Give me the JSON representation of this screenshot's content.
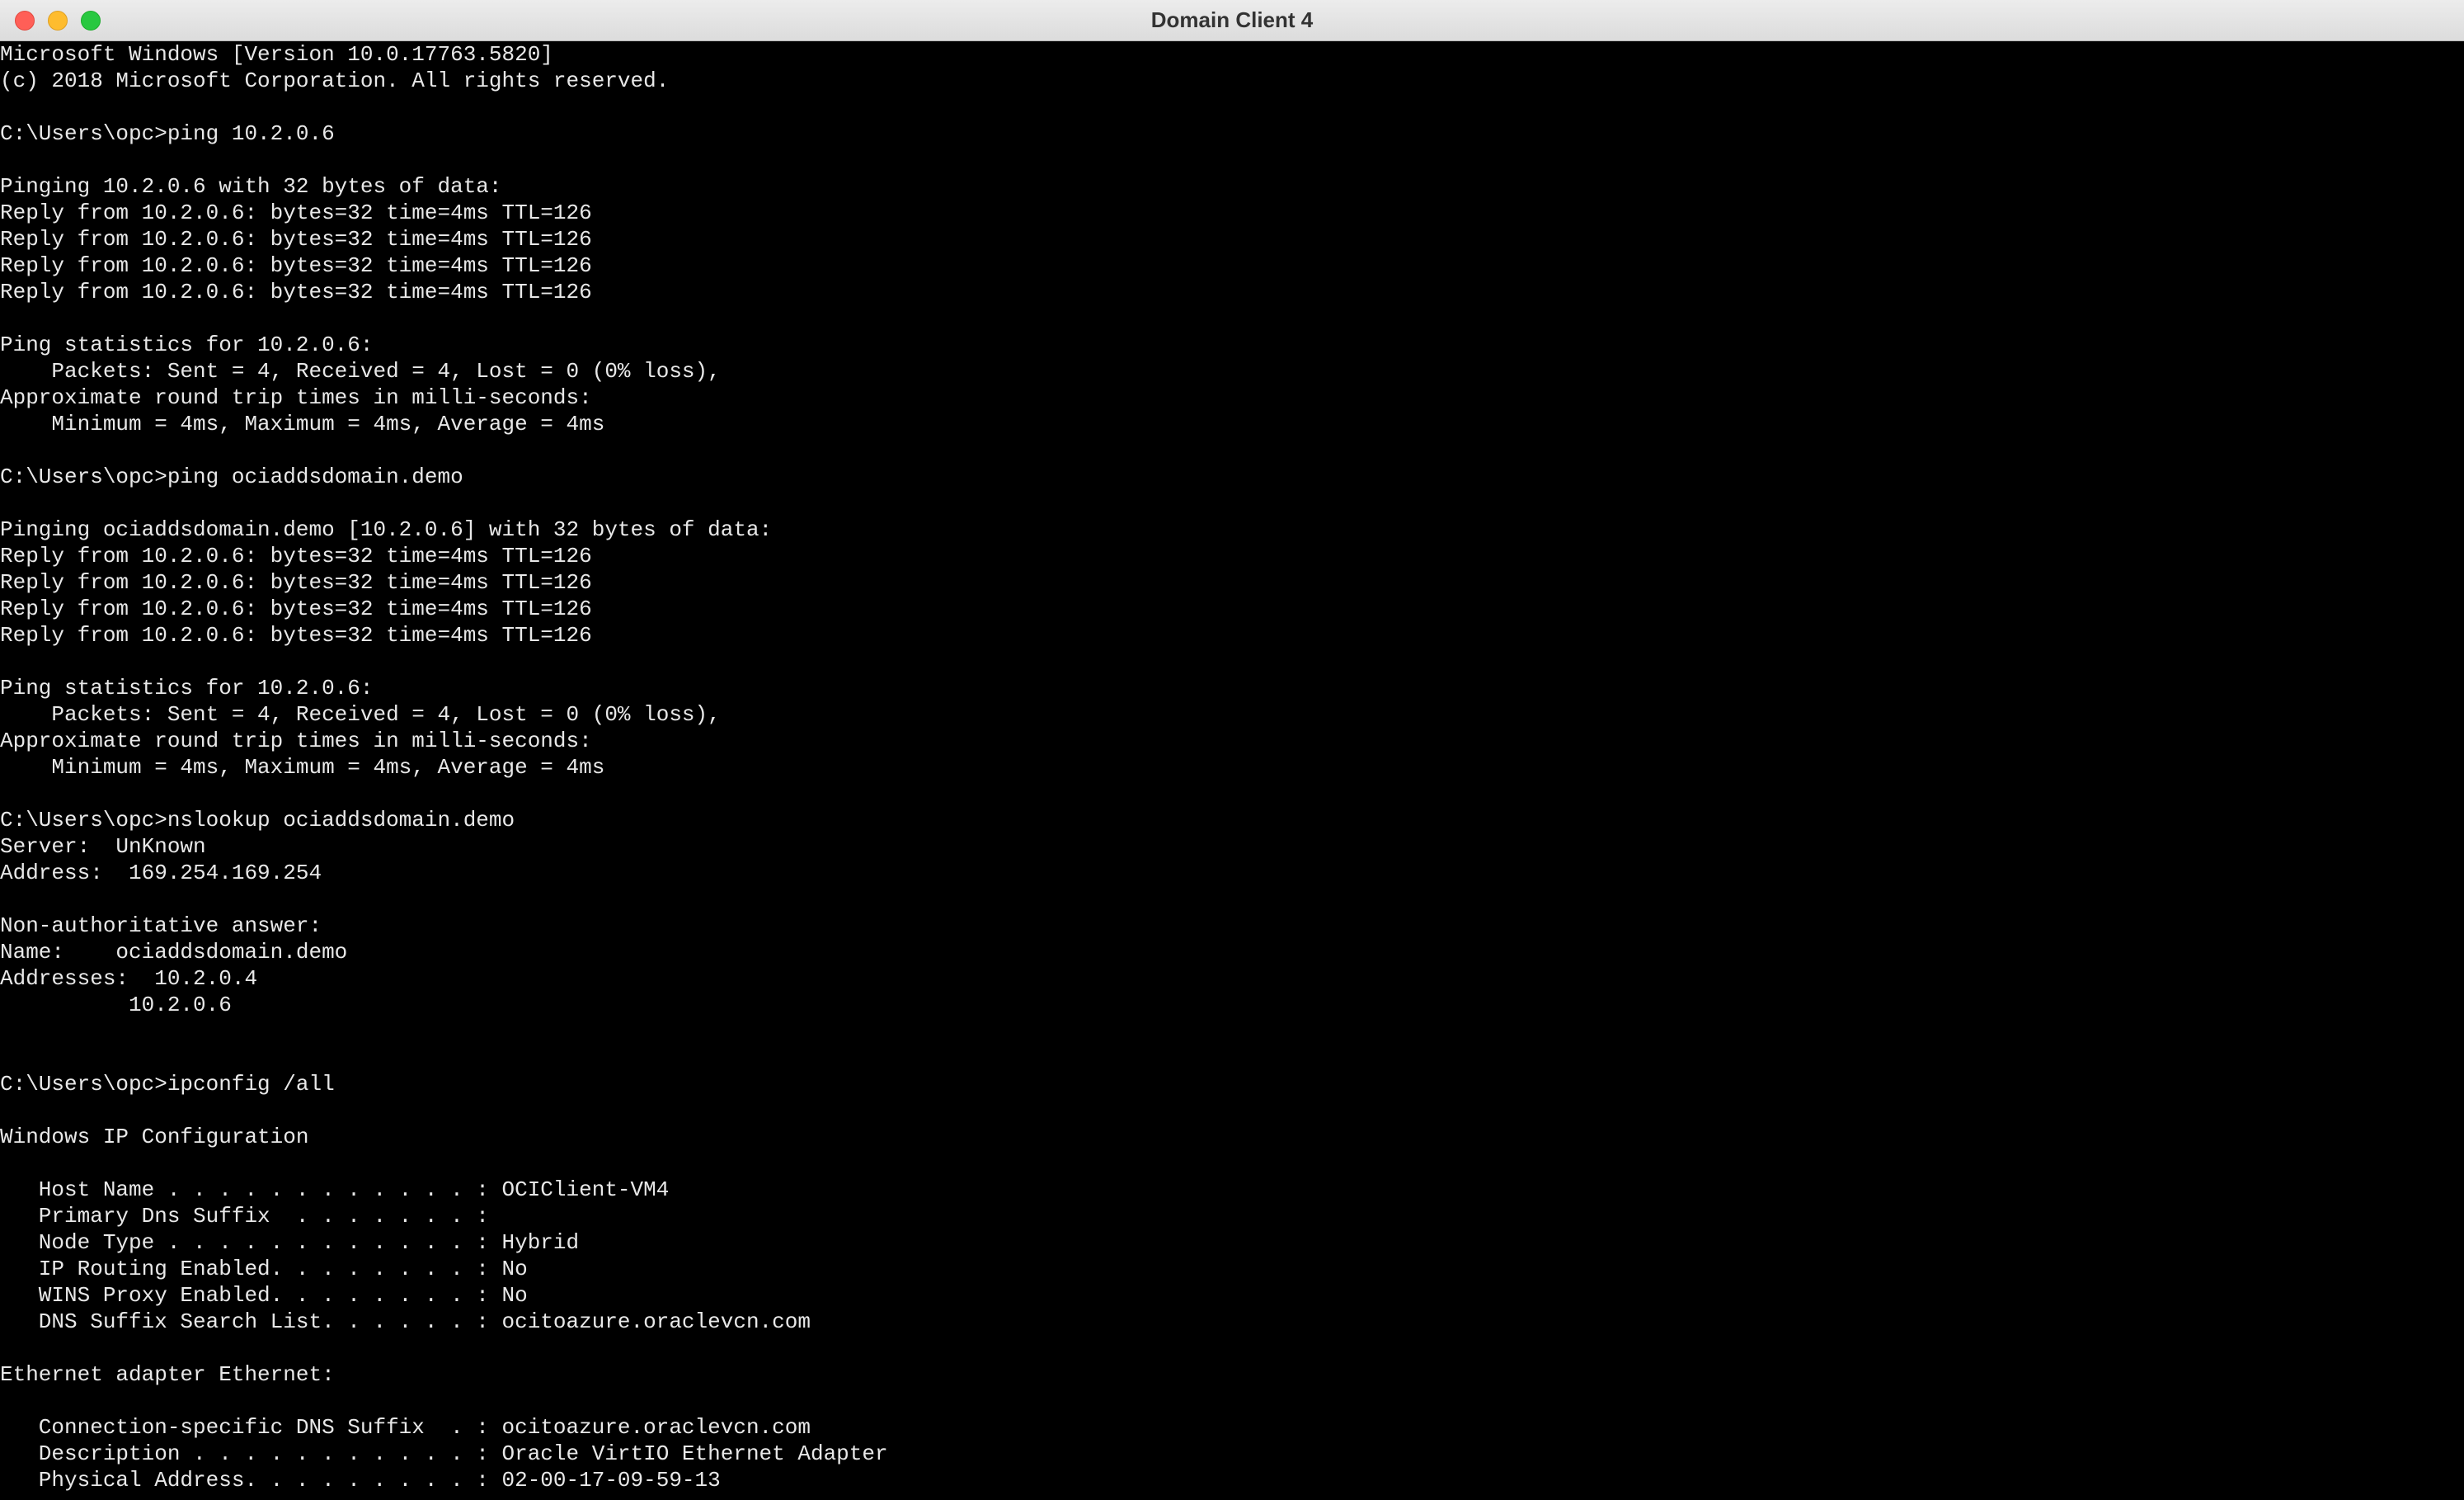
{
  "window": {
    "title": "Domain Client 4"
  },
  "terminal": {
    "lines": [
      "Microsoft Windows [Version 10.0.17763.5820]",
      "(c) 2018 Microsoft Corporation. All rights reserved.",
      "",
      "C:\\Users\\opc>ping 10.2.0.6",
      "",
      "Pinging 10.2.0.6 with 32 bytes of data:",
      "Reply from 10.2.0.6: bytes=32 time=4ms TTL=126",
      "Reply from 10.2.0.6: bytes=32 time=4ms TTL=126",
      "Reply from 10.2.0.6: bytes=32 time=4ms TTL=126",
      "Reply from 10.2.0.6: bytes=32 time=4ms TTL=126",
      "",
      "Ping statistics for 10.2.0.6:",
      "    Packets: Sent = 4, Received = 4, Lost = 0 (0% loss),",
      "Approximate round trip times in milli-seconds:",
      "    Minimum = 4ms, Maximum = 4ms, Average = 4ms",
      "",
      "C:\\Users\\opc>ping ociaddsdomain.demo",
      "",
      "Pinging ociaddsdomain.demo [10.2.0.6] with 32 bytes of data:",
      "Reply from 10.2.0.6: bytes=32 time=4ms TTL=126",
      "Reply from 10.2.0.6: bytes=32 time=4ms TTL=126",
      "Reply from 10.2.0.6: bytes=32 time=4ms TTL=126",
      "Reply from 10.2.0.6: bytes=32 time=4ms TTL=126",
      "",
      "Ping statistics for 10.2.0.6:",
      "    Packets: Sent = 4, Received = 4, Lost = 0 (0% loss),",
      "Approximate round trip times in milli-seconds:",
      "    Minimum = 4ms, Maximum = 4ms, Average = 4ms",
      "",
      "C:\\Users\\opc>nslookup ociaddsdomain.demo",
      "Server:  UnKnown",
      "Address:  169.254.169.254",
      "",
      "Non-authoritative answer:",
      "Name:    ociaddsdomain.demo",
      "Addresses:  10.2.0.4",
      "          10.2.0.6",
      "",
      "",
      "C:\\Users\\opc>ipconfig /all",
      "",
      "Windows IP Configuration",
      "",
      "   Host Name . . . . . . . . . . . . : OCIClient-VM4",
      "   Primary Dns Suffix  . . . . . . . :",
      "   Node Type . . . . . . . . . . . . : Hybrid",
      "   IP Routing Enabled. . . . . . . . : No",
      "   WINS Proxy Enabled. . . . . . . . : No",
      "   DNS Suffix Search List. . . . . . : ocitoazure.oraclevcn.com",
      "",
      "Ethernet adapter Ethernet:",
      "",
      "   Connection-specific DNS Suffix  . : ocitoazure.oraclevcn.com",
      "   Description . . . . . . . . . . . : Oracle VirtIO Ethernet Adapter",
      "   Physical Address. . . . . . . . . : 02-00-17-09-59-13"
    ]
  }
}
